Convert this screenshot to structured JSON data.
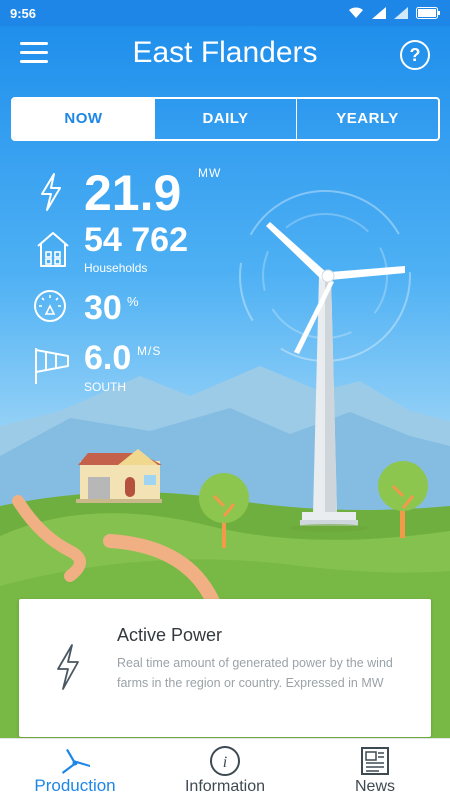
{
  "status_bar": {
    "time": "9:56"
  },
  "header": {
    "title": "East Flanders",
    "help_label": "?"
  },
  "tabs": [
    {
      "label": "NOW",
      "active": true
    },
    {
      "label": "DAILY",
      "active": false
    },
    {
      "label": "YEARLY",
      "active": false
    }
  ],
  "stats": {
    "power": {
      "value": "21.9",
      "unit": "MW",
      "icon": "lightning-icon"
    },
    "households": {
      "value": "54 762",
      "label": "Households",
      "icon": "house-icon"
    },
    "capacity": {
      "value": "30",
      "unit": "%",
      "icon": "gauge-icon"
    },
    "wind": {
      "value": "6.0",
      "unit": "M/S",
      "direction": "SOUTH",
      "icon": "windsock-icon"
    }
  },
  "info_card": {
    "title": "Active Power",
    "description": "Real time amount of generated power by the wind farms in the region or country. Expressed in MW",
    "icon": "lightning-icon"
  },
  "bottom_nav": [
    {
      "label": "Production",
      "icon": "turbine-icon",
      "active": true
    },
    {
      "label": "Information",
      "icon": "info-icon",
      "active": false
    },
    {
      "label": "News",
      "icon": "newspaper-icon",
      "active": false
    }
  ],
  "colors": {
    "accent": "#1d86e6",
    "sky_top": "#1f8fec",
    "grass": "#7ab847"
  }
}
